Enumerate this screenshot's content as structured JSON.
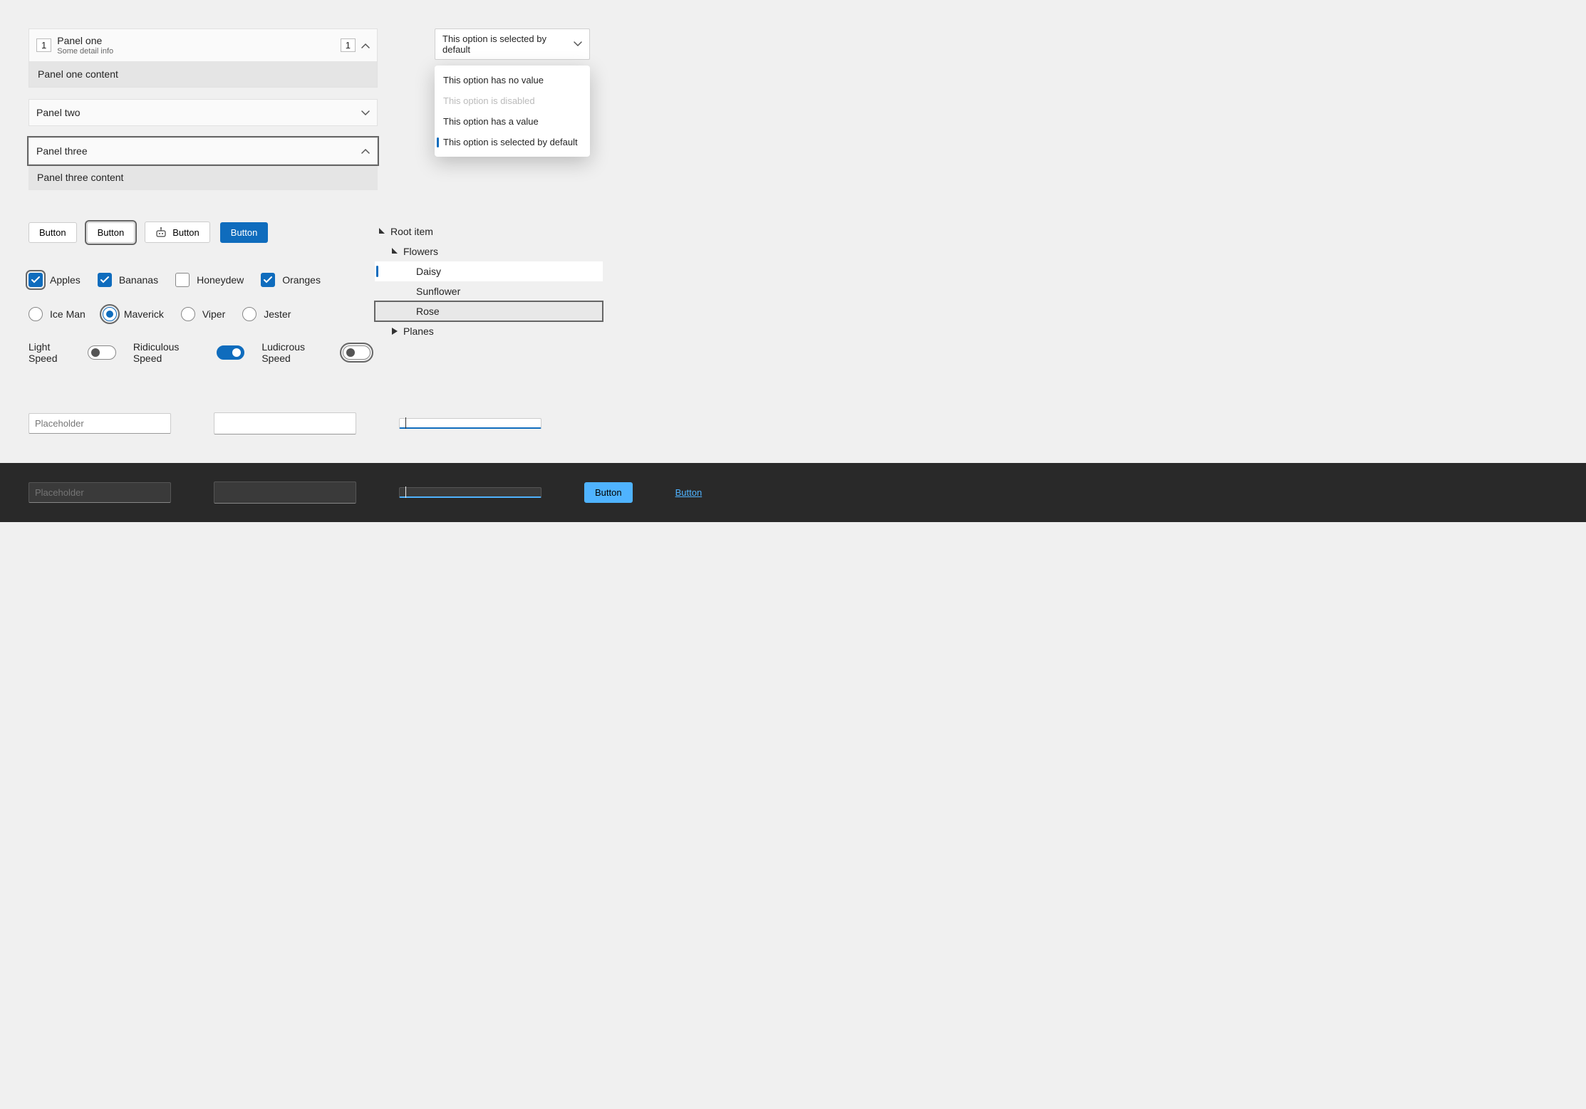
{
  "accordion": {
    "items": [
      {
        "badge_left": "1",
        "title": "Panel one",
        "subtitle": "Some detail info",
        "badge_right": "1",
        "content": "Panel one content"
      },
      {
        "title": "Panel two"
      },
      {
        "title": "Panel three",
        "content": "Panel three content"
      }
    ]
  },
  "select": {
    "value": "This option is selected by default",
    "options": [
      {
        "label": "This option has no value"
      },
      {
        "label": "This option is disabled"
      },
      {
        "label": "This option has a value"
      },
      {
        "label": "This option is selected by default"
      }
    ]
  },
  "buttons": {
    "b1": "Button",
    "b2": "Button",
    "b3": "Button",
    "b4": "Button"
  },
  "checks": {
    "apples": "Apples",
    "bananas": "Bananas",
    "honeydew": "Honeydew",
    "oranges": "Oranges"
  },
  "radios": {
    "iceman": "Ice Man",
    "maverick": "Maverick",
    "viper": "Viper",
    "jester": "Jester"
  },
  "switches": {
    "light": "Light Speed",
    "ridiculous": "Ridiculous Speed",
    "ludicrous": "Ludicrous Speed"
  },
  "tree": {
    "root": "Root item",
    "flowers": "Flowers",
    "daisy": "Daisy",
    "sunflower": "Sunflower",
    "rose": "Rose",
    "planes": "Planes"
  },
  "inputs": {
    "placeholder": "Placeholder"
  },
  "dark": {
    "placeholder": "Placeholder",
    "button": "Button",
    "link": "Button"
  },
  "colors": {
    "accent": "#0f6cbd",
    "accent_dark": "#4fb3ff"
  }
}
